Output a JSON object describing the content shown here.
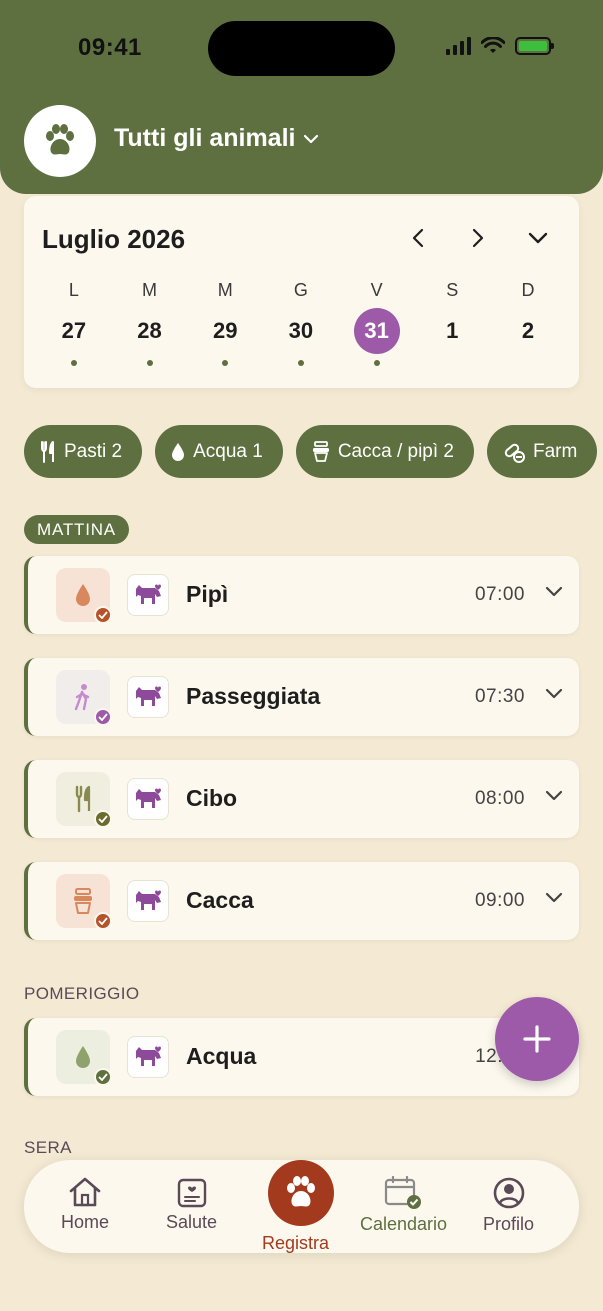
{
  "status_bar": {
    "time": "09:41"
  },
  "header": {
    "pet_selector": "Tutti gli animali"
  },
  "calendar": {
    "month_title": "Luglio 2026",
    "days": [
      {
        "dow": "L",
        "num": "27",
        "dot": true
      },
      {
        "dow": "M",
        "num": "28",
        "dot": true
      },
      {
        "dow": "M",
        "num": "29",
        "dot": true
      },
      {
        "dow": "G",
        "num": "30",
        "dot": true
      },
      {
        "dow": "V",
        "num": "31",
        "dot": true,
        "selected": true
      },
      {
        "dow": "S",
        "num": "1",
        "dot": false
      },
      {
        "dow": "D",
        "num": "2",
        "dot": false
      }
    ]
  },
  "chips": [
    {
      "label": "Pasti 2",
      "icon": "fork-knife-icon"
    },
    {
      "label": "Acqua 1",
      "icon": "water-drop-icon"
    },
    {
      "label": "Cacca / pipì 2",
      "icon": "poop-icon"
    },
    {
      "label": "Farm",
      "icon": "pill-icon"
    }
  ],
  "sections": {
    "morning": "MATTINA",
    "afternoon": "POMERIGGIO",
    "evening": "SERA"
  },
  "events": [
    {
      "title": "Pipì",
      "time": "07:00",
      "icon": "drop-icon",
      "icon_bg": "#F6E3D6",
      "icon_color": "#D9875C",
      "badge_color": "#B5532B"
    },
    {
      "title": "Passeggiata",
      "time": "07:30",
      "icon": "walk-icon",
      "icon_bg": "#F0EDEA",
      "icon_color": "#C58ACF",
      "badge_color": "#9C5AA8"
    },
    {
      "title": "Cibo",
      "time": "08:00",
      "icon": "fork-knife-icon",
      "icon_bg": "#EFEEDF",
      "icon_color": "#8A8A50",
      "badge_color": "#6B6A2F"
    },
    {
      "title": "Cacca",
      "time": "09:00",
      "icon": "poop-icon",
      "icon_bg": "#F6E3D6",
      "icon_color": "#D9875C",
      "badge_color": "#B5532B"
    },
    {
      "title": "Acqua",
      "time": "12:",
      "icon": "drop-icon",
      "icon_bg": "#ECEEDF",
      "icon_color": "#8FA26B",
      "badge_color": "#5E7040"
    }
  ],
  "tabs": {
    "home": "Home",
    "health": "Salute",
    "log": "Registra",
    "calendar": "Calendario",
    "profile": "Profilo"
  },
  "colors": {
    "brand_green": "#5E7040",
    "accent_purple": "#9C5AA8",
    "accent_red": "#A33A1E",
    "background": "#F4EAD3",
    "card": "#FCF8EE"
  }
}
